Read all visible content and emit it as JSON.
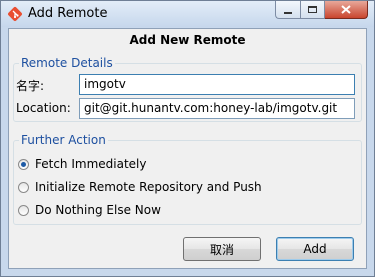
{
  "window": {
    "title": "Add Remote",
    "icon": "git-diamond-icon"
  },
  "caption": {
    "minimize": "minimize-icon",
    "maximize": "maximize-icon",
    "close": "close-icon"
  },
  "dialog": {
    "heading": "Add New Remote"
  },
  "remote_details": {
    "legend": "Remote Details",
    "name_label": "名字:",
    "name_value": "imgotv",
    "location_label": "Location:",
    "location_value": "git@git.hunantv.com:honey-lab/imgotv.git"
  },
  "further_action": {
    "legend": "Further Action",
    "options": [
      {
        "label": "Fetch Immediately",
        "checked": true
      },
      {
        "label": "Initialize Remote Repository and Push",
        "checked": false
      },
      {
        "label": "Do Nothing Else Now",
        "checked": false
      }
    ]
  },
  "buttons": {
    "cancel": "取消",
    "add": "Add"
  },
  "colors": {
    "legend": "#1e50a0",
    "close_button": "#c9452e",
    "git_icon": "#e94e31"
  }
}
